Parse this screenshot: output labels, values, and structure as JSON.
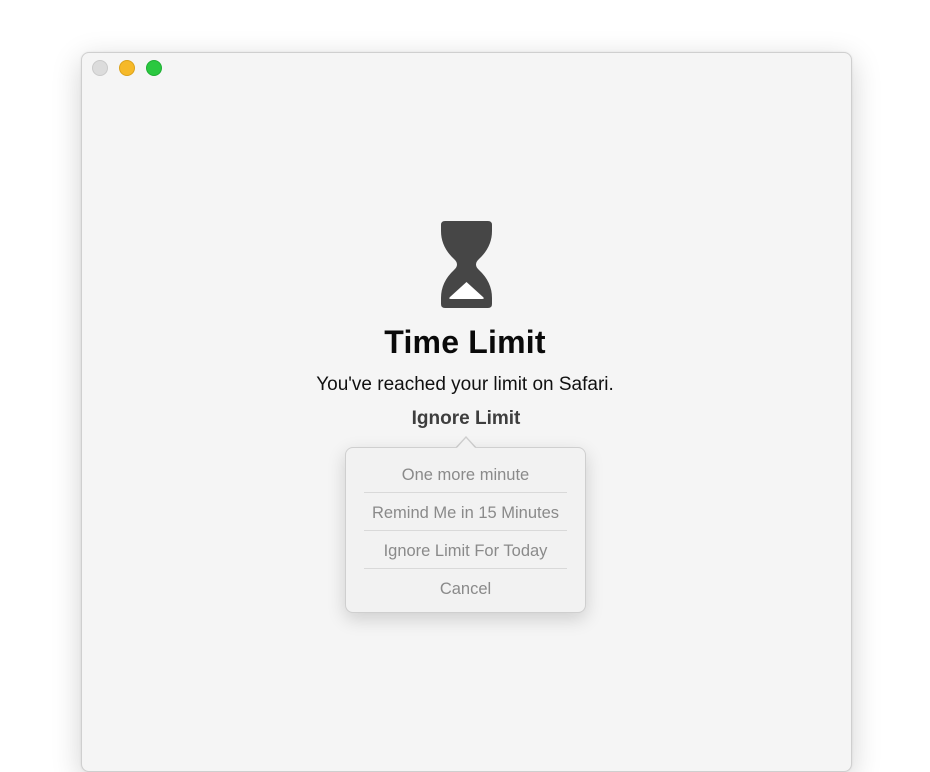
{
  "window": {
    "traffic_lights": {
      "close_color": "#dcdcdc",
      "minimize_color": "#f6b928",
      "zoom_color": "#2ac840"
    }
  },
  "content": {
    "icon": "hourglass-icon",
    "title": "Time Limit",
    "message": "You've reached your limit on Safari.",
    "ignore_button_label": "Ignore Limit"
  },
  "popover_menu": {
    "items": [
      {
        "label": "One more minute"
      },
      {
        "label": "Remind Me in 15 Minutes"
      },
      {
        "label": "Ignore Limit For Today"
      },
      {
        "label": "Cancel"
      }
    ]
  }
}
